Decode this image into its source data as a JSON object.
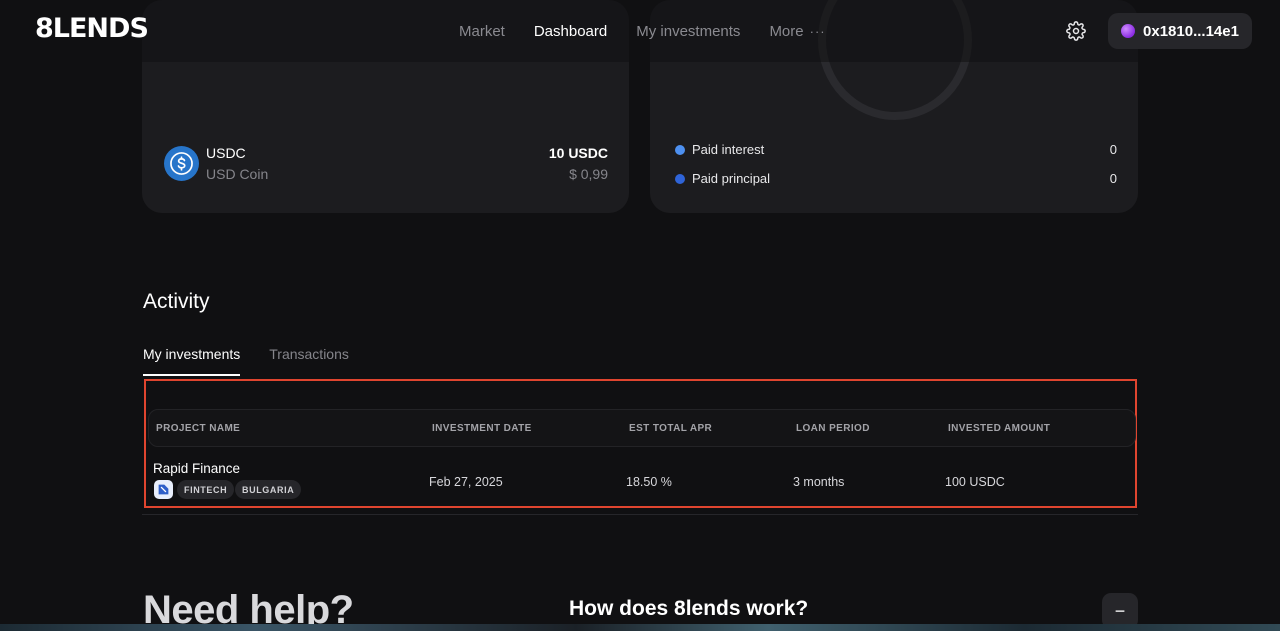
{
  "header": {
    "logo": "8LENDS",
    "nav": [
      "Market",
      "Dashboard",
      "My investments",
      "More"
    ],
    "more_dots": "···",
    "wallet": "0x1810...14e1"
  },
  "balance_card": {
    "symbol": "USDC",
    "name": "USD Coin",
    "amount": "10 USDC",
    "value": "$ 0,99"
  },
  "breakdown_card": {
    "legend": [
      {
        "label": "Paid interest",
        "value": "0",
        "color": "#4d90f0"
      },
      {
        "label": "Paid principal",
        "value": "0",
        "color": "#2f64d8"
      }
    ]
  },
  "activity": {
    "title": "Activity",
    "tabs": [
      "My investments",
      "Transactions"
    ],
    "columns": [
      "PROJECT NAME",
      "INVESTMENT DATE",
      "EST TOTAL APR",
      "LOAN PERIOD",
      "INVESTED AMOUNT"
    ],
    "rows": [
      {
        "project": "Rapid Finance",
        "tags": [
          "FINTECH",
          "BULGARIA"
        ],
        "date": "Feb 27, 2025",
        "apr": "18.50 %",
        "period": "3 months",
        "amount": "100 USDC"
      }
    ]
  },
  "help": {
    "title": "Need help?",
    "question": "How does 8lends work?",
    "toggle": "−"
  },
  "colors": {
    "accent_highlight": "#e0452f",
    "usdc": "#2775ca",
    "wallet_dot": "#8a2be2"
  }
}
